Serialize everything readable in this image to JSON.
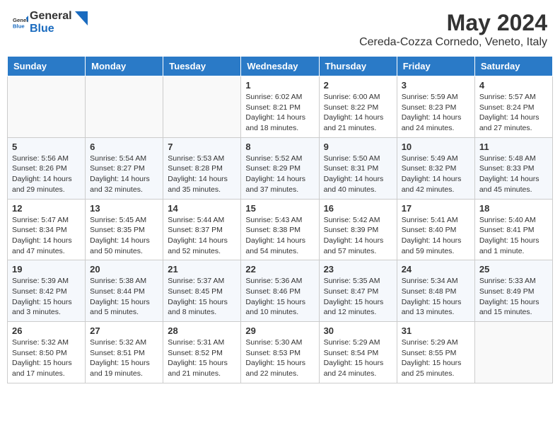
{
  "header": {
    "logo_general": "General",
    "logo_blue": "Blue",
    "title": "May 2024",
    "subtitle": "Cereda-Cozza Cornedo, Veneto, Italy"
  },
  "weekdays": [
    "Sunday",
    "Monday",
    "Tuesday",
    "Wednesday",
    "Thursday",
    "Friday",
    "Saturday"
  ],
  "weeks": [
    [
      {
        "day": "",
        "info": ""
      },
      {
        "day": "",
        "info": ""
      },
      {
        "day": "",
        "info": ""
      },
      {
        "day": "1",
        "info": "Sunrise: 6:02 AM\nSunset: 8:21 PM\nDaylight: 14 hours and 18 minutes."
      },
      {
        "day": "2",
        "info": "Sunrise: 6:00 AM\nSunset: 8:22 PM\nDaylight: 14 hours and 21 minutes."
      },
      {
        "day": "3",
        "info": "Sunrise: 5:59 AM\nSunset: 8:23 PM\nDaylight: 14 hours and 24 minutes."
      },
      {
        "day": "4",
        "info": "Sunrise: 5:57 AM\nSunset: 8:24 PM\nDaylight: 14 hours and 27 minutes."
      }
    ],
    [
      {
        "day": "5",
        "info": "Sunrise: 5:56 AM\nSunset: 8:26 PM\nDaylight: 14 hours and 29 minutes."
      },
      {
        "day": "6",
        "info": "Sunrise: 5:54 AM\nSunset: 8:27 PM\nDaylight: 14 hours and 32 minutes."
      },
      {
        "day": "7",
        "info": "Sunrise: 5:53 AM\nSunset: 8:28 PM\nDaylight: 14 hours and 35 minutes."
      },
      {
        "day": "8",
        "info": "Sunrise: 5:52 AM\nSunset: 8:29 PM\nDaylight: 14 hours and 37 minutes."
      },
      {
        "day": "9",
        "info": "Sunrise: 5:50 AM\nSunset: 8:31 PM\nDaylight: 14 hours and 40 minutes."
      },
      {
        "day": "10",
        "info": "Sunrise: 5:49 AM\nSunset: 8:32 PM\nDaylight: 14 hours and 42 minutes."
      },
      {
        "day": "11",
        "info": "Sunrise: 5:48 AM\nSunset: 8:33 PM\nDaylight: 14 hours and 45 minutes."
      }
    ],
    [
      {
        "day": "12",
        "info": "Sunrise: 5:47 AM\nSunset: 8:34 PM\nDaylight: 14 hours and 47 minutes."
      },
      {
        "day": "13",
        "info": "Sunrise: 5:45 AM\nSunset: 8:35 PM\nDaylight: 14 hours and 50 minutes."
      },
      {
        "day": "14",
        "info": "Sunrise: 5:44 AM\nSunset: 8:37 PM\nDaylight: 14 hours and 52 minutes."
      },
      {
        "day": "15",
        "info": "Sunrise: 5:43 AM\nSunset: 8:38 PM\nDaylight: 14 hours and 54 minutes."
      },
      {
        "day": "16",
        "info": "Sunrise: 5:42 AM\nSunset: 8:39 PM\nDaylight: 14 hours and 57 minutes."
      },
      {
        "day": "17",
        "info": "Sunrise: 5:41 AM\nSunset: 8:40 PM\nDaylight: 14 hours and 59 minutes."
      },
      {
        "day": "18",
        "info": "Sunrise: 5:40 AM\nSunset: 8:41 PM\nDaylight: 15 hours and 1 minute."
      }
    ],
    [
      {
        "day": "19",
        "info": "Sunrise: 5:39 AM\nSunset: 8:42 PM\nDaylight: 15 hours and 3 minutes."
      },
      {
        "day": "20",
        "info": "Sunrise: 5:38 AM\nSunset: 8:44 PM\nDaylight: 15 hours and 5 minutes."
      },
      {
        "day": "21",
        "info": "Sunrise: 5:37 AM\nSunset: 8:45 PM\nDaylight: 15 hours and 8 minutes."
      },
      {
        "day": "22",
        "info": "Sunrise: 5:36 AM\nSunset: 8:46 PM\nDaylight: 15 hours and 10 minutes."
      },
      {
        "day": "23",
        "info": "Sunrise: 5:35 AM\nSunset: 8:47 PM\nDaylight: 15 hours and 12 minutes."
      },
      {
        "day": "24",
        "info": "Sunrise: 5:34 AM\nSunset: 8:48 PM\nDaylight: 15 hours and 13 minutes."
      },
      {
        "day": "25",
        "info": "Sunrise: 5:33 AM\nSunset: 8:49 PM\nDaylight: 15 hours and 15 minutes."
      }
    ],
    [
      {
        "day": "26",
        "info": "Sunrise: 5:32 AM\nSunset: 8:50 PM\nDaylight: 15 hours and 17 minutes."
      },
      {
        "day": "27",
        "info": "Sunrise: 5:32 AM\nSunset: 8:51 PM\nDaylight: 15 hours and 19 minutes."
      },
      {
        "day": "28",
        "info": "Sunrise: 5:31 AM\nSunset: 8:52 PM\nDaylight: 15 hours and 21 minutes."
      },
      {
        "day": "29",
        "info": "Sunrise: 5:30 AM\nSunset: 8:53 PM\nDaylight: 15 hours and 22 minutes."
      },
      {
        "day": "30",
        "info": "Sunrise: 5:29 AM\nSunset: 8:54 PM\nDaylight: 15 hours and 24 minutes."
      },
      {
        "day": "31",
        "info": "Sunrise: 5:29 AM\nSunset: 8:55 PM\nDaylight: 15 hours and 25 minutes."
      },
      {
        "day": "",
        "info": ""
      }
    ]
  ]
}
